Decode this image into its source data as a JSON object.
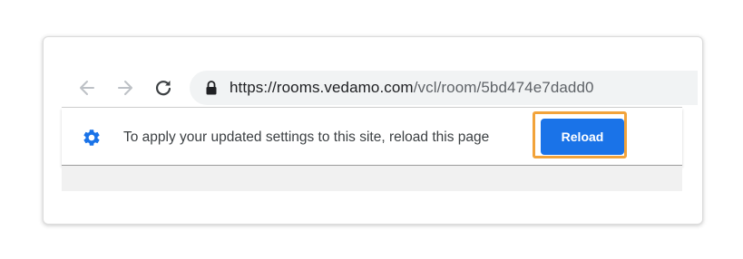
{
  "toolbar": {
    "back_icon": "back-arrow-icon",
    "forward_icon": "forward-arrow-icon",
    "reload_icon": "reload-icon",
    "address": {
      "lock_icon": "lock-icon",
      "host": "https://rooms.vedamo.com",
      "path": "/vcl/room/5bd474e7dadd0"
    }
  },
  "infobar": {
    "icon": "gear-icon",
    "message": "To apply your updated settings to this site, reload this page",
    "reload_label": "Reload",
    "accent_color": "#1a73e8",
    "highlight_color": "#f2a33a"
  }
}
